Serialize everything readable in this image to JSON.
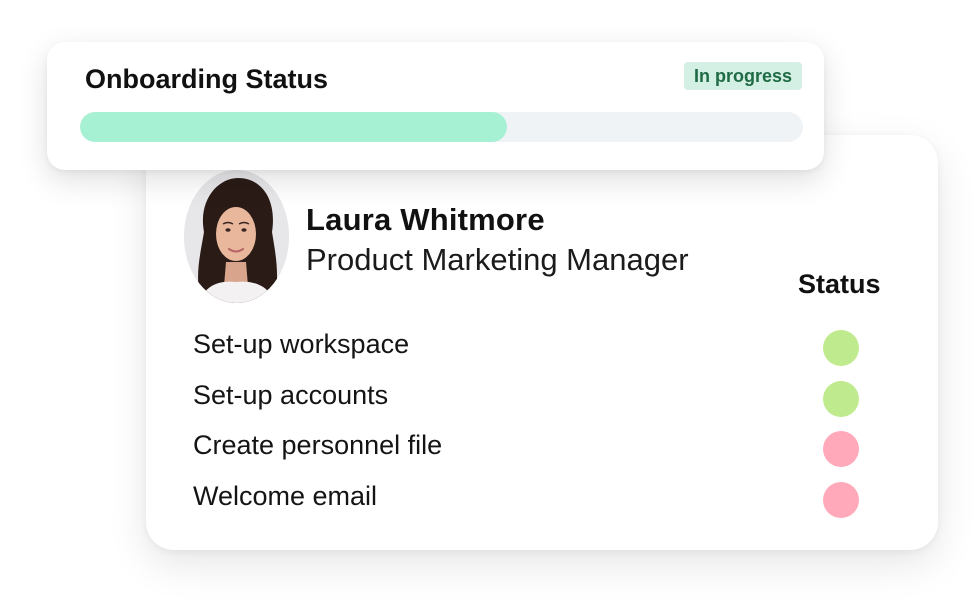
{
  "onboarding": {
    "title": "Onboarding Status",
    "badge": "In progress",
    "progress": 0.59,
    "colors": {
      "fill": "#a6f0d4",
      "track": "#f0f3f6",
      "badge_bg": "#d4efe3",
      "badge_text": "#1f6b45"
    }
  },
  "profile": {
    "name": "Laura Whitmore",
    "job_title": "Product Marketing Manager",
    "avatar_icon": "person-photo"
  },
  "checklist": {
    "status_header": "Status",
    "tasks": [
      {
        "label": "Set-up workspace",
        "status": "complete",
        "color": "#bfeb8e"
      },
      {
        "label": "Set-up accounts",
        "status": "complete",
        "color": "#bfeb8e"
      },
      {
        "label": "Create personnel file",
        "status": "incomplete",
        "color": "#ffa9bb"
      },
      {
        "label": "Welcome email",
        "status": "incomplete",
        "color": "#ffa9bb"
      }
    ]
  }
}
